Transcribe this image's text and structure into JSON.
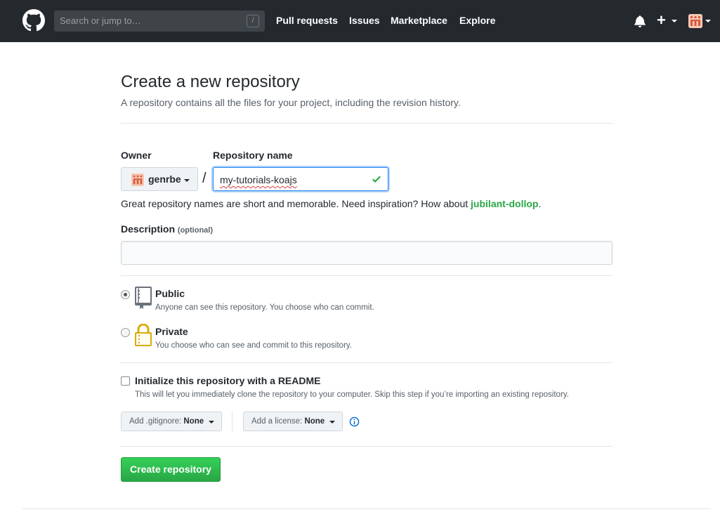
{
  "header": {
    "search_placeholder": "Search or jump to…",
    "search_key": "/",
    "nav": [
      "Pull requests",
      "Issues",
      "Marketplace",
      "Explore"
    ],
    "plus_label": "+"
  },
  "page": {
    "title": "Create a new repository",
    "subtitle": "A repository contains all the files for your project, including the revision history."
  },
  "form": {
    "owner_label": "Owner",
    "owner_value": "genrbe",
    "separator": "/",
    "repo_label": "Repository name",
    "repo_value": "my-tutorials-koajs",
    "hint_prefix": "Great repository names are short and memorable. Need inspiration? How about ",
    "hint_link": "jubilant-dollop",
    "hint_suffix": ".",
    "description_label": "Description",
    "description_optional": "(optional)",
    "description_value": "",
    "visibility": {
      "public_title": "Public",
      "public_desc": "Anyone can see this repository. You choose who can commit.",
      "private_title": "Private",
      "private_desc": "You choose who can see and commit to this repository.",
      "selected": "public"
    },
    "readme_title": "Initialize this repository with a README",
    "readme_desc": "This will let you immediately clone the repository to your computer. Skip this step if you’re importing an existing repository.",
    "readme_checked": false,
    "gitignore_prefix": "Add .gitignore: ",
    "gitignore_value": "None",
    "license_prefix": "Add a license: ",
    "license_value": "None",
    "create_label": "Create repository"
  },
  "colors": {
    "header_bg": "#24292e",
    "accent_green": "#28a745",
    "focus_blue": "#2188ff",
    "info_blue": "#0366d6"
  }
}
